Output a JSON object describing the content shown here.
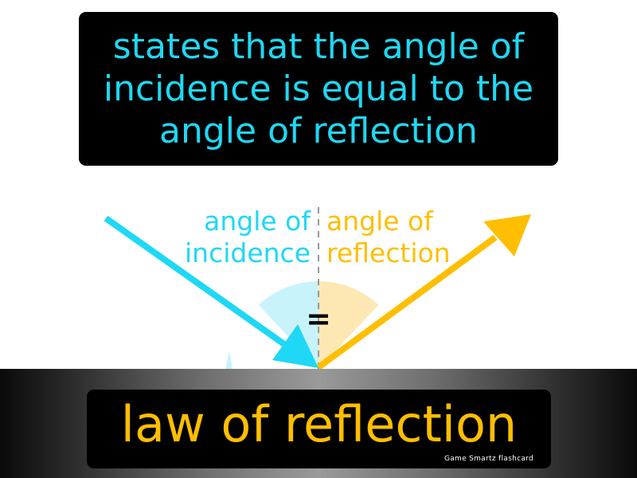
{
  "definition": {
    "text": "states that the angle of incidence is equal to the angle of reflection",
    "color": "#1ed8f5"
  },
  "diagram": {
    "incidence_label": "angle of incidence",
    "reflection_label": "angle of reflection",
    "equals_sign": "=",
    "incidence_color": "#1ed8f5",
    "reflection_color": "#ffbe00",
    "incidence_sector_color": "#c9f3fb",
    "reflection_sector_color": "#fde8b4"
  },
  "term": {
    "text": "law of reflection",
    "color": "#ffbe00"
  },
  "brand": {
    "text": "Game Smartz flashcard"
  }
}
